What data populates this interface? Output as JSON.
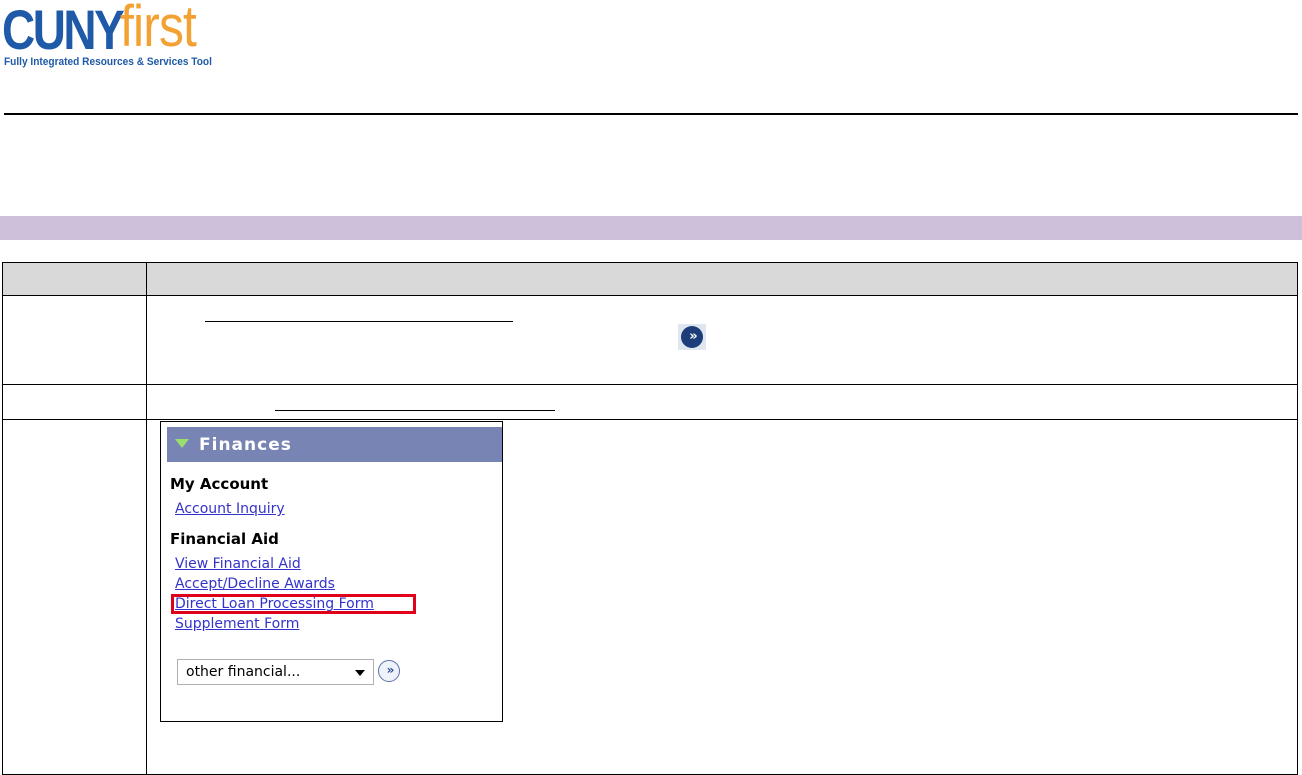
{
  "logo": {
    "brand_primary": "CUNY",
    "brand_secondary": "first",
    "tagline": "Fully Integrated Resources & Services Tool",
    "colors": {
      "primary": "#1f5aa8",
      "secondary": "#f4a133"
    }
  },
  "section_band_color": "#ccc0da",
  "finances_panel": {
    "title": "Finances",
    "my_account": {
      "heading": "My Account",
      "links": [
        "Account Inquiry"
      ]
    },
    "financial_aid": {
      "heading": "Financial Aid",
      "links": [
        "View Financial Aid",
        "Accept/Decline Awards",
        "Direct Loan Processing Form",
        "Supplement Form"
      ]
    },
    "highlighted_link": "Direct Loan Processing Form",
    "select": {
      "value": "other financial..."
    },
    "go_icon": "double-chevron-right-icon",
    "header_color": "#7884b4",
    "highlight_color": "#e0001a"
  }
}
